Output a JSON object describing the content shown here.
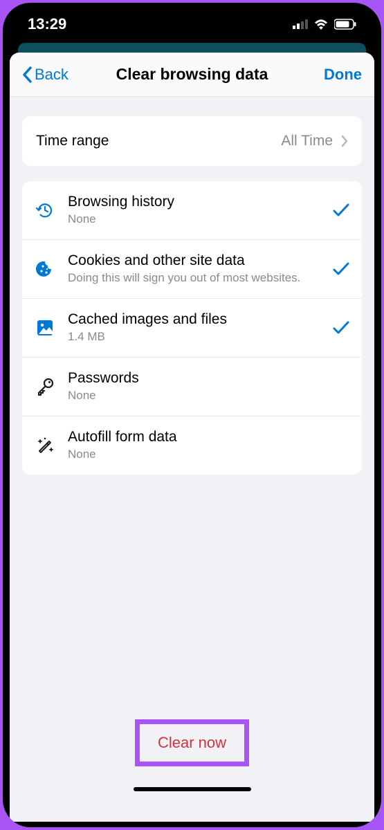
{
  "status": {
    "time": "13:29"
  },
  "nav": {
    "back": "Back",
    "title": "Clear browsing data",
    "done": "Done"
  },
  "time_range": {
    "label": "Time range",
    "value": "All Time"
  },
  "options": [
    {
      "icon": "history",
      "title": "Browsing history",
      "sub": "None",
      "checked": true
    },
    {
      "icon": "cookie",
      "title": "Cookies and other site data",
      "sub": "Doing this will sign you out of most websites.",
      "checked": true
    },
    {
      "icon": "cache",
      "title": "Cached images and files",
      "sub": "1.4 MB",
      "checked": true
    },
    {
      "icon": "key",
      "title": "Passwords",
      "sub": "None",
      "checked": false
    },
    {
      "icon": "wand",
      "title": "Autofill form data",
      "sub": "None",
      "checked": false
    }
  ],
  "footer": {
    "clear_now": "Clear now"
  }
}
